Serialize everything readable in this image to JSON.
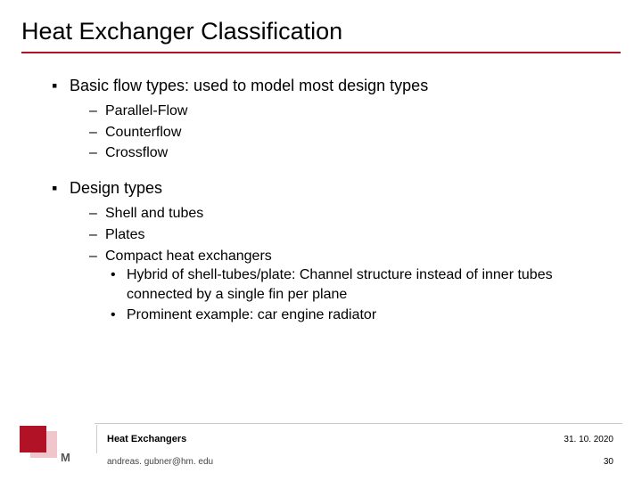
{
  "title": "Heat Exchanger Classification",
  "items": {
    "a": {
      "label": "Basic flow types: used to model most design types",
      "sub": {
        "0": "Parallel-Flow",
        "1": "Counterflow",
        "2": "Crossflow"
      }
    },
    "b": {
      "label": "Design types",
      "sub": {
        "0": "Shell and tubes",
        "1": "Plates",
        "2": {
          "label": "Compact heat exchangers",
          "sub": {
            "0": "Hybrid of shell-tubes/plate: Channel structure instead of inner tubes connected by a single fin per plane",
            "1": "Prominent example: car engine radiator"
          }
        }
      }
    }
  },
  "footer": {
    "subject": "Heat  Exchangers",
    "email": "andreas. gubner@hm. edu",
    "date": "31. 10. 2020",
    "page": "30"
  },
  "logo_letter": "M"
}
